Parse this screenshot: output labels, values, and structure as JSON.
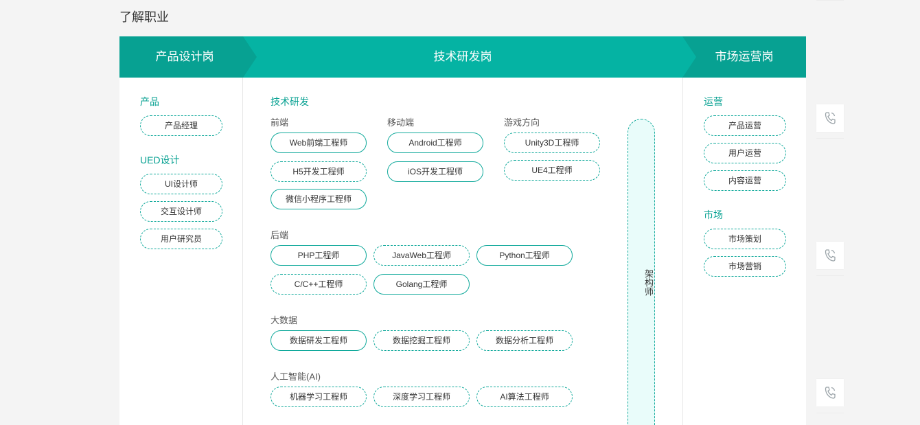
{
  "page": {
    "title": "了解职业"
  },
  "banner": {
    "left": "产品设计岗",
    "center": "技术研发岗",
    "right": "市场运营岗",
    "colors": {
      "dark": "#07a192",
      "light": "#05b3a3"
    }
  },
  "left": {
    "product": {
      "title": "产品",
      "items": [
        "产品经理"
      ]
    },
    "ued": {
      "title": "UED设计",
      "items": [
        "UI设计师",
        "交互设计师",
        "用户研究员"
      ]
    }
  },
  "middle": {
    "title": "技术研发",
    "frontend": {
      "title": "前端",
      "items": [
        "Web前端工程师",
        "H5开发工程师",
        "微信小程序工程师"
      ]
    },
    "mobile": {
      "title": "移动端",
      "items": [
        "Android工程师",
        "iOS开发工程师"
      ]
    },
    "game": {
      "title": "游戏方向",
      "items": [
        "Unity3D工程师",
        "UE4工程师"
      ]
    },
    "backend": {
      "title": "后端",
      "items": [
        "PHP工程师",
        "JavaWeb工程师",
        "Python工程师",
        "C/C++工程师",
        "Golang工程师"
      ]
    },
    "bigdata": {
      "title": "大数据",
      "items": [
        "数据研发工程师",
        "数据挖掘工程师",
        "数据分析工程师"
      ]
    },
    "ai": {
      "title": "人工智能(AI)",
      "items": [
        "机器学习工程师",
        "深度学习工程师",
        "AI算法工程师"
      ]
    },
    "architect": "架构师"
  },
  "right": {
    "ops": {
      "title": "运营",
      "items": [
        "产品运营",
        "用户运营",
        "内容运营"
      ]
    },
    "market": {
      "title": "市场",
      "items": [
        "市场策划",
        "市场营销"
      ]
    }
  },
  "sidebar": {
    "icon": "phone-icon",
    "count": 3
  }
}
